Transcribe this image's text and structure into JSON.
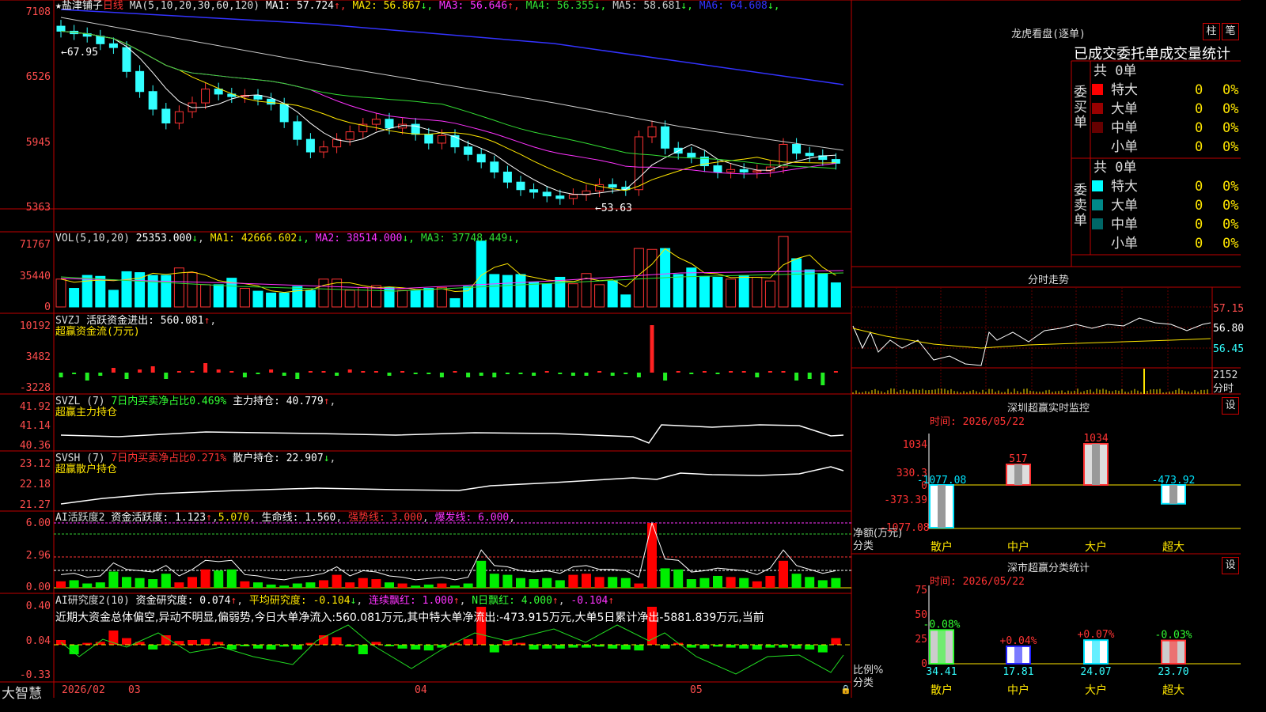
{
  "stock": {
    "name": "盐津铺子",
    "period": "日线",
    "ma_params": "MA(5,10,20,30,60,120)",
    "ma": [
      {
        "label": "MA1:",
        "value": "57.724",
        "arrow": "↑",
        "color": "#ffffff"
      },
      {
        "label": "MA2:",
        "value": "56.867",
        "arrow": "↓",
        "color": "#ffe600"
      },
      {
        "label": "MA3:",
        "value": "56.646",
        "arrow": "↑",
        "color": "#ff33ff"
      },
      {
        "label": "MA4:",
        "value": "56.355",
        "arrow": "↓",
        "color": "#33dd33"
      },
      {
        "label": "MA5:",
        "value": "58.681",
        "arrow": "↓",
        "color": "#cccccc"
      },
      {
        "label": "MA6:",
        "value": "64.608",
        "arrow": "↓",
        "color": "#3333ff"
      }
    ],
    "price_axis": [
      "7108",
      "6526",
      "5945",
      "5363"
    ],
    "high_label": "67.95",
    "low_label": "53.63"
  },
  "vol": {
    "label": "VOL(5,10,20)",
    "value": "25353.000",
    "arrow": "↓",
    "ma": [
      {
        "label": "MA1:",
        "value": "42666.602",
        "arrow": "↓",
        "color": "#ffe600"
      },
      {
        "label": "MA2:",
        "value": "38514.000",
        "arrow": "↓",
        "color": "#ff33ff"
      },
      {
        "label": "MA3:",
        "value": "37748.449",
        "arrow": "↓",
        "color": "#33dd33"
      }
    ],
    "axis": [
      "71767",
      "35440",
      "0"
    ]
  },
  "svzj": {
    "title": "SVZJ",
    "desc": "活跃资金进出:",
    "value": "560.081",
    "arrow": "↑",
    "sub": "超赢资金流(万元)",
    "axis": [
      "10192",
      "3482",
      "-3228"
    ]
  },
  "svzl": {
    "title": "SVZL (7)",
    "desc": "7日内买卖净占比0.469%",
    "hold_label": "主力持仓:",
    "value": "40.779",
    "arrow": "↑",
    "sub": "超赢主力持仓",
    "axis": [
      "41.92",
      "41.14",
      "40.36"
    ]
  },
  "svsh": {
    "title": "SVSH (7)",
    "desc": "7日内买卖净占比0.271%",
    "hold_label": "散户持仓:",
    "value": "22.907",
    "arrow": "↓",
    "sub": "超赢散户持仓",
    "axis": [
      "23.12",
      "22.18",
      "21.27"
    ]
  },
  "ai_act": {
    "title": "AI活跃度2",
    "desc": "资金活跃度:",
    "value": "1.123",
    "v2": "5.070",
    "life_label": "生命线:",
    "life": "1.560",
    "strong_label": "强势线:",
    "strong": "3.000",
    "burst_label": "爆发线:",
    "burst": "6.000",
    "axis": [
      "6.00",
      "2.96",
      "0.00"
    ]
  },
  "ai_res": {
    "title": "AI研究度2(10)",
    "desc": "资金研究度:",
    "value": "0.074",
    "avg_label": "平均研究度:",
    "avg": "-0.104",
    "red_label": "连续飘红:",
    "red": "1.000",
    "nred_label": "N日飘红:",
    "nred": "4.000",
    "last": "-0.104",
    "comment": "近期大资金总体偏空,异动不明显,偏弱势,今日大单净流入:560.081万元,其中特大单净流出:-473.915万元,大单5日累计净出-5881.839万元,当前",
    "axis": [
      "0.40",
      "0.04",
      "-0.33"
    ]
  },
  "date_axis": [
    "2026/02",
    "03",
    "04",
    "05"
  ],
  "brand": "大智慧",
  "lhb": {
    "title": "龙虎看盘(逐单)",
    "btn1": "柱",
    "btn2": "笔",
    "tabs": "已成交委托单成交量统计",
    "buy_label": "委买单",
    "sell_label": "委卖单",
    "buy_total": "共 0单",
    "sell_total": "共 0单",
    "rows": [
      {
        "name": "特大",
        "count": "0",
        "pct": "0%",
        "color": "#ff0000"
      },
      {
        "name": "大单",
        "count": "0",
        "pct": "0%",
        "color": "#990000"
      },
      {
        "name": "中单",
        "count": "0",
        "pct": "0%",
        "color": "#660000"
      },
      {
        "name": "小单",
        "count": "0",
        "pct": "0%",
        "color": "#000000"
      }
    ],
    "sell_rows": [
      {
        "name": "特大",
        "count": "0",
        "pct": "0%",
        "color": "#00ffff"
      },
      {
        "name": "大单",
        "count": "0",
        "pct": "0%",
        "color": "#008888"
      },
      {
        "name": "中单",
        "count": "0",
        "pct": "0%",
        "color": "#006666"
      },
      {
        "name": "小单",
        "count": "0",
        "pct": "0%",
        "color": "#000000"
      }
    ]
  },
  "intraday": {
    "title": "分时走势",
    "axis": [
      "57.15",
      "56.80",
      "56.45"
    ],
    "vol_axis": "2152",
    "vol_label": "分时"
  },
  "monitor": {
    "title": "深圳超赢实时监控",
    "btn": "设",
    "time": "时间: 2026/05/22",
    "axis": [
      "1034",
      "330.3",
      "0",
      "-373.39",
      "-1077.08"
    ],
    "ylabel1": "净额(万元)",
    "ylabel2": "分类",
    "bars": [
      {
        "cat": "散户",
        "value": "-1077.08"
      },
      {
        "cat": "中户",
        "value": "517"
      },
      {
        "cat": "大户",
        "value": "1034"
      },
      {
        "cat": "超大",
        "value": "-473.92"
      }
    ]
  },
  "classify": {
    "title": "深市超赢分类统计",
    "btn": "设",
    "time": "时间: 2026/05/22",
    "axis": [
      "75",
      "50",
      "25",
      "0"
    ],
    "ylabel1": "比例%",
    "ylabel2": "分类",
    "bars": [
      {
        "cat": "散户",
        "value": "34.41",
        "change": "-0.08%"
      },
      {
        "cat": "中户",
        "value": "17.81",
        "change": "+0.04%"
      },
      {
        "cat": "大户",
        "value": "24.07",
        "change": "+0.07%"
      },
      {
        "cat": "超大",
        "value": "23.70",
        "change": "-0.03%"
      }
    ]
  },
  "chart_data": [
    {
      "type": "bar",
      "title": "深圳超赢实时监控",
      "categories": [
        "散户",
        "中户",
        "大户",
        "超大"
      ],
      "values": [
        -1077.08,
        517,
        1034,
        -473.92
      ],
      "ylabel": "净额(万元)",
      "ylim": [
        -1077.08,
        1034
      ]
    },
    {
      "type": "bar",
      "title": "深市超赢分类统计",
      "categories": [
        "散户",
        "中户",
        "大户",
        "超大"
      ],
      "values": [
        34.41,
        17.81,
        24.07,
        23.7
      ],
      "ylabel": "比例%",
      "ylim": [
        0,
        75
      ]
    }
  ]
}
